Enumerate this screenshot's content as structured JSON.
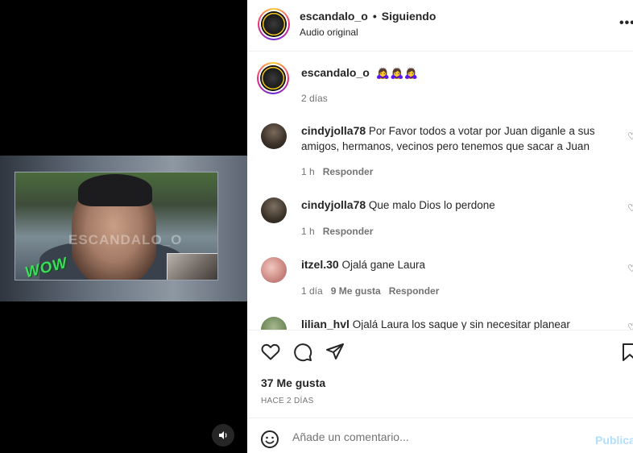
{
  "post": {
    "username": "escandalo_o",
    "follow_status": "Siguiendo",
    "audio": "Audio original",
    "caption_emojis": "🙇‍♀️🙇‍♀️🙇‍♀️",
    "caption_time": "2 días",
    "video_watermark": "ESCANDALO_O",
    "video_sticker": "WOW"
  },
  "comments": [
    {
      "username": "cindyjolla78",
      "text": "Por Favor todos a votar por Juan diganle a sus amigos, hermanos, vecinos pero tenemos que sacar a Juan",
      "time": "1 h",
      "likes": "",
      "reply": "Responder"
    },
    {
      "username": "cindyjolla78",
      "text": "Que malo Dios lo perdone",
      "time": "1 h",
      "likes": "",
      "reply": "Responder"
    },
    {
      "username": "itzel.30",
      "text": "Ojalá gane Laura",
      "time": "1 día",
      "likes": "9 Me gusta",
      "reply": "Responder"
    },
    {
      "username": "lilian_hvl",
      "text": "Ojalá Laura los saque y sin necesitar planear",
      "time": "",
      "likes": "",
      "reply": ""
    }
  ],
  "actions": {
    "likes_count": "37 Me gusta",
    "date": "HACE 2 DÍAS"
  },
  "add_comment": {
    "placeholder": "Añade un comentario...",
    "publish_label": "Publicar"
  },
  "icons": {
    "more": "more-options-icon",
    "like": "heart-icon",
    "comment": "comment-icon",
    "share": "share-icon",
    "save": "bookmark-icon",
    "emoji": "emoji-icon",
    "sound": "speaker-icon"
  }
}
